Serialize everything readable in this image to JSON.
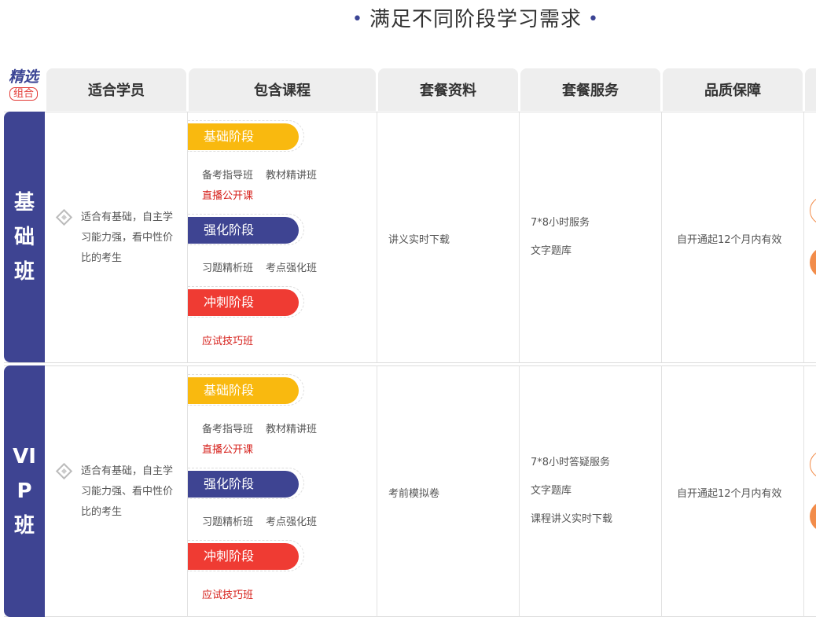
{
  "page_title": "满足不同阶段学习需求",
  "logo": {
    "line1": "精选",
    "line2": "组合"
  },
  "headers": [
    "适合学员",
    "包含课程",
    "套餐资料",
    "套餐服务",
    "品质保障"
  ],
  "stage_labels": {
    "basic": "基础阶段",
    "strengthen": "强化阶段",
    "sprint": "冲刺阶段"
  },
  "stage_colors": {
    "basic": "#f9b90f",
    "strengthen": "#3e4492",
    "sprint": "#ef3b33"
  },
  "rows": [
    {
      "label_lines": [
        "基",
        "础",
        "班"
      ],
      "fit": "适合有基础，自主学习能力强，看中性价比的考生",
      "basic_courses": [
        "备考指导班",
        "教材精讲班"
      ],
      "basic_live": "直播公开课",
      "strengthen_courses": [
        "习题精析班",
        "考点强化班"
      ],
      "sprint_courses": [
        "应试技巧班"
      ],
      "materials": "讲义实时下载",
      "services": [
        "7*8小时服务",
        "文字题库"
      ],
      "guarantee": "自开通起12个月内有效"
    },
    {
      "label_lines": [
        "VI",
        "P",
        "班"
      ],
      "fit": "适合有基础，自主学习能力强、看中性价比的考生",
      "basic_courses": [
        "备考指导班",
        "教材精讲班"
      ],
      "basic_live": "直播公开课",
      "strengthen_courses": [
        "习题精析班",
        "考点强化班"
      ],
      "sprint_courses": [
        "应试技巧班"
      ],
      "materials": "考前模拟卷",
      "services": [
        "7*8小时答疑服务",
        "文字题库",
        "课程讲义实时下载"
      ],
      "guarantee": "自开通起12个月内有效"
    }
  ]
}
